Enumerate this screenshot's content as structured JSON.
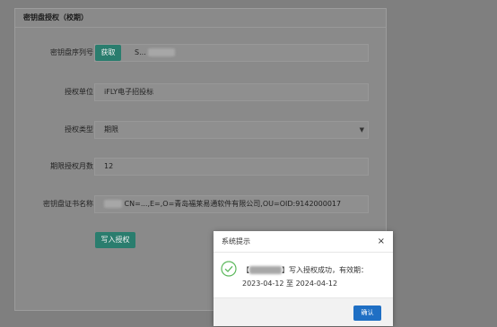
{
  "panel": {
    "title": "密钥盘授权（校期）"
  },
  "form": {
    "serial": {
      "label": "密钥盘序列号",
      "button": "获取",
      "value": "S..."
    },
    "unit": {
      "label": "授权单位",
      "value": "iFLY电子招投标"
    },
    "type": {
      "label": "授权类型",
      "value": "期限"
    },
    "months": {
      "label": "期限授权月数",
      "value": "12"
    },
    "cert": {
      "label": "密钥盘证书名称",
      "value": "CN=...,E=,O=青岛福莱易通软件有限公司,OU=OID:9142000017"
    },
    "submit_label": "写入授权"
  },
  "dialog": {
    "title": "系统提示",
    "close_glyph": "×",
    "message_open": "【",
    "message_text": "】写入授权成功，有效期：2023-04-12 至 2024-04-12",
    "confirm_label": "确认"
  },
  "colors": {
    "accent_green": "#2a7d6e",
    "accent_blue": "#1f6fc4",
    "success": "#5cb85c"
  }
}
